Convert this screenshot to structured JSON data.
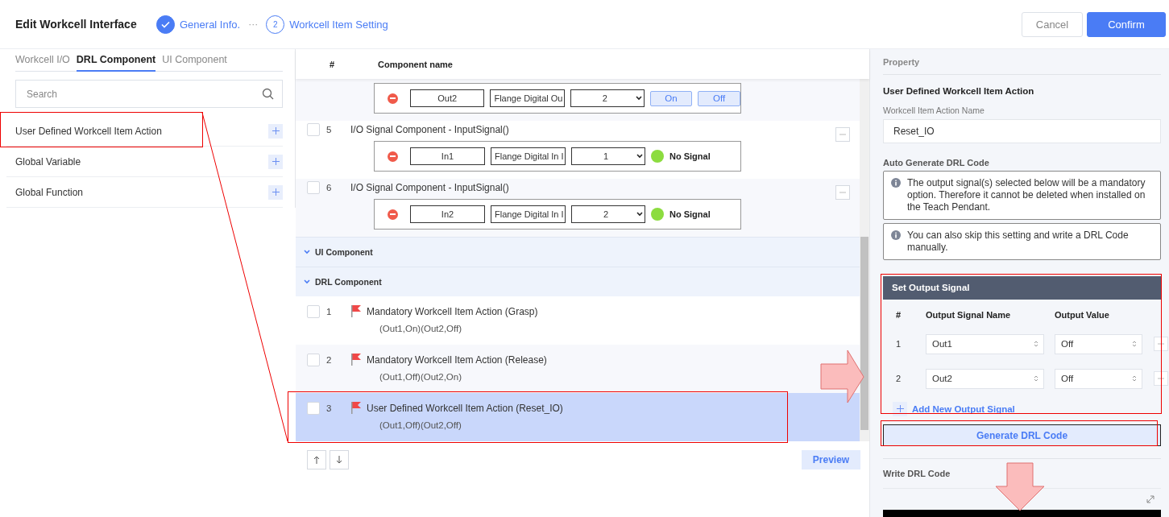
{
  "header": {
    "title": "Edit Workcell Interface",
    "steps": [
      {
        "label": "General Info.",
        "done": true
      },
      {
        "number": "2",
        "label": "Workcell Item Setting",
        "done": false
      }
    ],
    "step_separator": "···",
    "buttons": [
      {
        "label": "Cancel",
        "kind": "secondary"
      },
      {
        "label": "Confirm",
        "kind": "primary"
      }
    ]
  },
  "left_panel": {
    "tabs": [
      {
        "label": "Workcell I/O",
        "selected": false
      },
      {
        "label": "DRL Component",
        "selected": true
      },
      {
        "label": "UI Component",
        "selected": false
      }
    ],
    "search": {
      "placeholder": "Search"
    },
    "items": [
      {
        "label": "User Defined Workcell Item Action"
      },
      {
        "label": "Global Variable"
      },
      {
        "label": "Global Function"
      }
    ]
  },
  "component_list": {
    "columns": [
      "#",
      "Component name"
    ],
    "signal_rows": [
      {
        "kind": "output",
        "name": "Out2",
        "signal_type": "Flange Digital Ou",
        "index": "2",
        "buttons": [
          "On",
          "Off"
        ]
      },
      {
        "kind": "input",
        "number": "5",
        "checked": false,
        "title": "I/O Signal Component - InputSignal()",
        "name": "In1",
        "signal_type": "Flange Digital In I",
        "index": "1",
        "status": "No Signal"
      },
      {
        "kind": "input",
        "number": "6",
        "checked": false,
        "title": "I/O Signal Component - InputSignal()",
        "name": "In2",
        "signal_type": "Flange Digital In I",
        "index": "2",
        "status": "No Signal"
      }
    ],
    "sections": [
      {
        "label": "UI Component"
      },
      {
        "label": "DRL Component"
      }
    ],
    "drl_rows": [
      {
        "number": "1",
        "title": "Mandatory Workcell Item Action (Grasp)",
        "params": "(Out1,On)(Out2,Off)",
        "selected": false
      },
      {
        "number": "2",
        "title": "Mandatory Workcell Item Action (Release)",
        "params": "(Out1,Off)(Out2,On)",
        "selected": false
      },
      {
        "number": "3",
        "title": "User Defined Workcell Item Action (Reset_IO)",
        "params": "(Out1,Off)(Out2,Off)",
        "selected": true
      }
    ],
    "preview_button": "Preview"
  },
  "property": {
    "heading": "Property",
    "title": "User Defined Workcell Item Action",
    "name_field": {
      "label": "Workcell Item Action Name",
      "value": "Reset_IO"
    },
    "auto_label": "Auto Generate DRL Code",
    "notes": [
      "The output signal(s) selected below will be a mandatory option. Therefore it cannot be deleted when installed on the Teach Pendant.",
      "You can also skip this setting and write a DRL Code manually."
    ],
    "output_signal": {
      "title": "Set Output Signal",
      "columns": [
        "#",
        "Output Signal Name",
        "Output Value"
      ],
      "rows": [
        {
          "number": "1",
          "name": "Out1",
          "value": "Off"
        },
        {
          "number": "2",
          "name": "Out2",
          "value": "Off"
        }
      ],
      "add_label": "Add New Output Signal"
    },
    "generate_button": "Generate DRL Code",
    "write_label": "Write DRL Code"
  }
}
